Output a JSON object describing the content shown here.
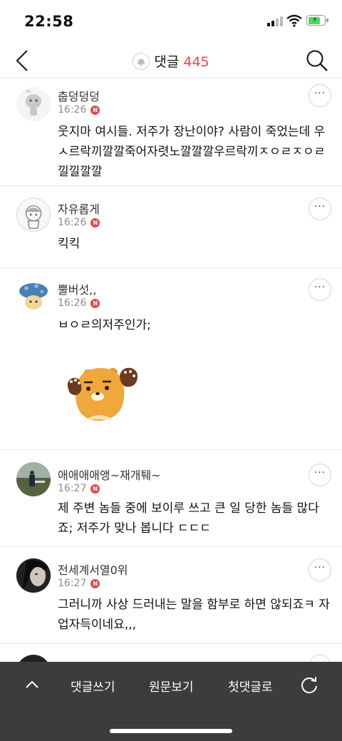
{
  "status_bar": {
    "time": "22:58"
  },
  "header": {
    "title": "댓글",
    "count": "445"
  },
  "comments": [
    {
      "nick": "춥덩덩덩",
      "time": "16:26",
      "badge": "N",
      "text": "웃지마 여시들. 저주가 장난이야? 사람이 죽었는데 우ㅅ르락끼깔깔죽어자렷노깔깔깔우르락끼ㅈㅇㄹㅈㅇㄹ낄낄깔깔"
    },
    {
      "nick": "자유롭게",
      "time": "16:26",
      "badge": "N",
      "text": "킥킥"
    },
    {
      "nick": "뿔버섯,,",
      "time": "16:26",
      "badge": "N",
      "text": "ㅂㅇㄹ의저주인가;"
    },
    {
      "nick": "애애애애앵~재개퉤~",
      "time": "16:27",
      "badge": "N",
      "text": "제 주변 놈들 중에 보이루 쓰고 큰 일 당한 놈들 많다죠; 저주가 맞나 봅니다 ㄷㄷㄷ"
    },
    {
      "nick": "전세계서열0위",
      "time": "16:27",
      "badge": "N",
      "text": "그러니까 사상 드러내는 말을 함부로 하면 않되죠ㅋ 자업자득이네요,,,"
    }
  ],
  "more_label": "···",
  "bottom_bar": {
    "write": "댓글쓰기",
    "original": "원문보기",
    "first": "첫댓글로"
  },
  "colors": {
    "accent": "#e5474d",
    "bottom_bg": "#3c3c3c"
  },
  "icons": {
    "back": "chevron-left-icon",
    "search": "search-icon",
    "bell": "bell-icon",
    "up": "chevron-up-icon",
    "refresh": "refresh-icon"
  }
}
